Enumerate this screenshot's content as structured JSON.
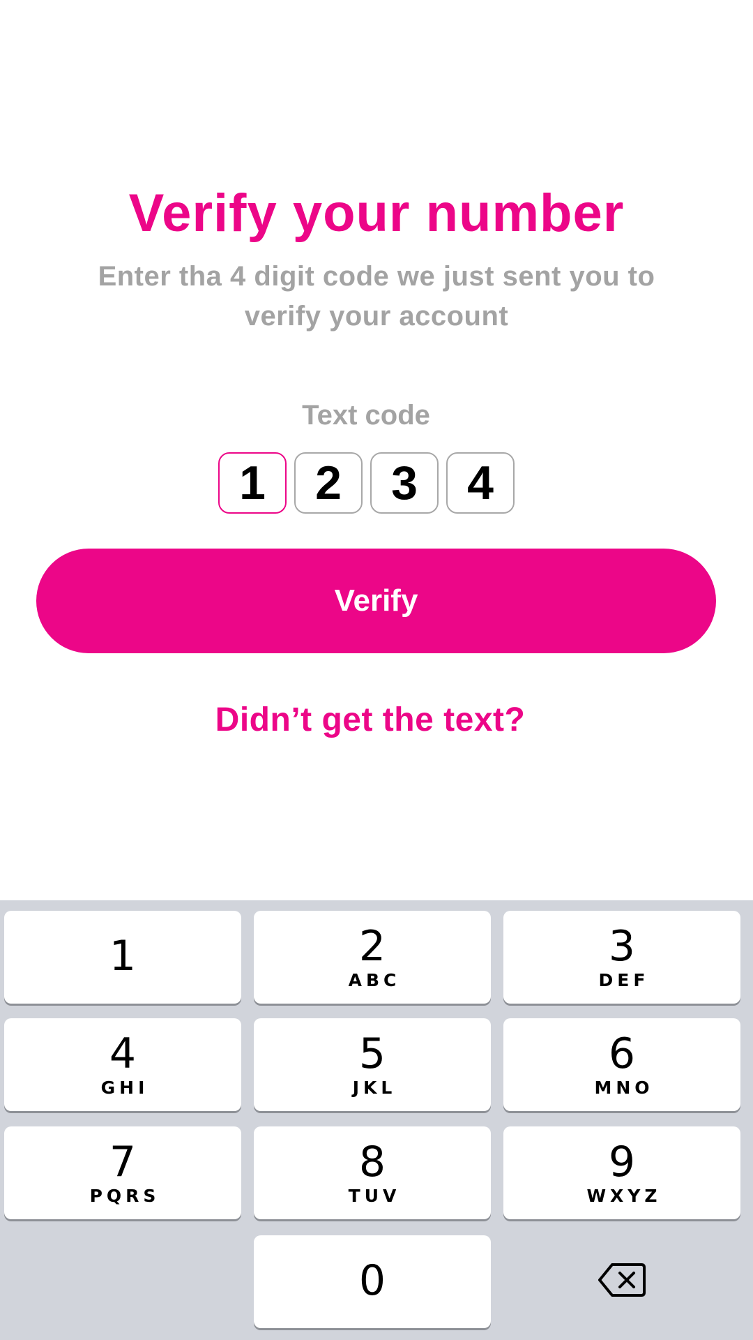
{
  "header": {
    "title": "Verify your number",
    "subtitle": "Enter tha 4 digit code we just sent you to verify your account"
  },
  "code": {
    "label": "Text code",
    "digits": [
      "1",
      "2",
      "3",
      "4"
    ]
  },
  "actions": {
    "verify_label": "Verify",
    "resend_label": "Didn’t get the text?"
  },
  "keyboard": {
    "keys": [
      {
        "num": "1",
        "letters": ""
      },
      {
        "num": "2",
        "letters": "ABC"
      },
      {
        "num": "3",
        "letters": "DEF"
      },
      {
        "num": "4",
        "letters": "GHI"
      },
      {
        "num": "5",
        "letters": "JKL"
      },
      {
        "num": "6",
        "letters": "MNO"
      },
      {
        "num": "7",
        "letters": "PQRS"
      },
      {
        "num": "8",
        "letters": "TUV"
      },
      {
        "num": "9",
        "letters": "WXYZ"
      },
      {
        "num": "0",
        "letters": ""
      }
    ],
    "backspace_icon": "delete-backward-icon"
  },
  "colors": {
    "accent": "#ec0688",
    "muted_text": "#a3a3a3",
    "keyboard_bg": "#d1d4db"
  }
}
